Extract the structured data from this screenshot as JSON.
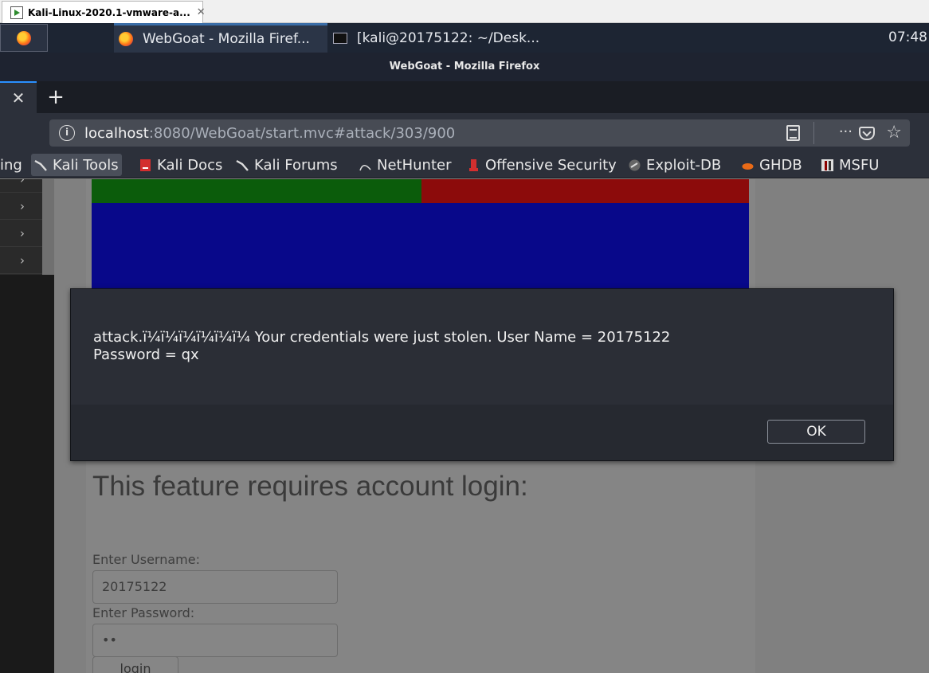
{
  "vmware": {
    "tab_title": "Kali-Linux-2020.1-vmware-a...",
    "tab_close": "✕"
  },
  "panel": {
    "tasks": [
      {
        "label": "WebGoat - Mozilla Firef..."
      },
      {
        "label": "[kali@20175122: ~/Desk..."
      }
    ],
    "clock": "07:48"
  },
  "firefox": {
    "window_title": "WebGoat - Mozilla Firefox",
    "tab_close": "✕",
    "new_tab": "+",
    "url": {
      "host": "localhost",
      "path": ":8080/WebGoat/start.mvc#attack/303/900"
    },
    "more": "···",
    "star": "☆",
    "bookmarks": [
      {
        "label": "ing"
      },
      {
        "label": "Kali Tools"
      },
      {
        "label": "Kali Docs"
      },
      {
        "label": "Kali Forums"
      },
      {
        "label": "NetHunter"
      },
      {
        "label": "Offensive Security"
      },
      {
        "label": "Exploit-DB"
      },
      {
        "label": "GHDB"
      },
      {
        "label": "MSFU"
      }
    ]
  },
  "sidebar": {
    "chevron": "›"
  },
  "page": {
    "login_heading": "This feature requires account login:",
    "username_label": "Enter Username:",
    "username_value": "20175122",
    "password_label": "Enter Password:",
    "password_value": "••",
    "login_button": "login"
  },
  "dialog": {
    "message": "attack.ï¼ï¼ï¼ï¼ï¼ï¼ Your credentials were just stolen. User Name = 20175122\nPassword = qx",
    "ok_button": "OK"
  },
  "colors": {
    "green_band": "#0b5c0b",
    "red_band": "#8c0b0b",
    "blue_band": "#08088a",
    "tab_accent": "#2a90ff"
  }
}
